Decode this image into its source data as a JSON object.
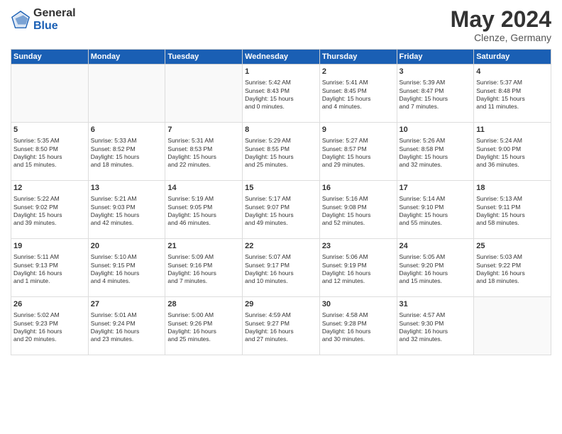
{
  "header": {
    "logo_general": "General",
    "logo_blue": "Blue",
    "month_title": "May 2024",
    "location": "Clenze, Germany"
  },
  "weekdays": [
    "Sunday",
    "Monday",
    "Tuesday",
    "Wednesday",
    "Thursday",
    "Friday",
    "Saturday"
  ],
  "weeks": [
    [
      {
        "day": "",
        "info": ""
      },
      {
        "day": "",
        "info": ""
      },
      {
        "day": "",
        "info": ""
      },
      {
        "day": "1",
        "info": "Sunrise: 5:42 AM\nSunset: 8:43 PM\nDaylight: 15 hours\nand 0 minutes."
      },
      {
        "day": "2",
        "info": "Sunrise: 5:41 AM\nSunset: 8:45 PM\nDaylight: 15 hours\nand 4 minutes."
      },
      {
        "day": "3",
        "info": "Sunrise: 5:39 AM\nSunset: 8:47 PM\nDaylight: 15 hours\nand 7 minutes."
      },
      {
        "day": "4",
        "info": "Sunrise: 5:37 AM\nSunset: 8:48 PM\nDaylight: 15 hours\nand 11 minutes."
      }
    ],
    [
      {
        "day": "5",
        "info": "Sunrise: 5:35 AM\nSunset: 8:50 PM\nDaylight: 15 hours\nand 15 minutes."
      },
      {
        "day": "6",
        "info": "Sunrise: 5:33 AM\nSunset: 8:52 PM\nDaylight: 15 hours\nand 18 minutes."
      },
      {
        "day": "7",
        "info": "Sunrise: 5:31 AM\nSunset: 8:53 PM\nDaylight: 15 hours\nand 22 minutes."
      },
      {
        "day": "8",
        "info": "Sunrise: 5:29 AM\nSunset: 8:55 PM\nDaylight: 15 hours\nand 25 minutes."
      },
      {
        "day": "9",
        "info": "Sunrise: 5:27 AM\nSunset: 8:57 PM\nDaylight: 15 hours\nand 29 minutes."
      },
      {
        "day": "10",
        "info": "Sunrise: 5:26 AM\nSunset: 8:58 PM\nDaylight: 15 hours\nand 32 minutes."
      },
      {
        "day": "11",
        "info": "Sunrise: 5:24 AM\nSunset: 9:00 PM\nDaylight: 15 hours\nand 36 minutes."
      }
    ],
    [
      {
        "day": "12",
        "info": "Sunrise: 5:22 AM\nSunset: 9:02 PM\nDaylight: 15 hours\nand 39 minutes."
      },
      {
        "day": "13",
        "info": "Sunrise: 5:21 AM\nSunset: 9:03 PM\nDaylight: 15 hours\nand 42 minutes."
      },
      {
        "day": "14",
        "info": "Sunrise: 5:19 AM\nSunset: 9:05 PM\nDaylight: 15 hours\nand 46 minutes."
      },
      {
        "day": "15",
        "info": "Sunrise: 5:17 AM\nSunset: 9:07 PM\nDaylight: 15 hours\nand 49 minutes."
      },
      {
        "day": "16",
        "info": "Sunrise: 5:16 AM\nSunset: 9:08 PM\nDaylight: 15 hours\nand 52 minutes."
      },
      {
        "day": "17",
        "info": "Sunrise: 5:14 AM\nSunset: 9:10 PM\nDaylight: 15 hours\nand 55 minutes."
      },
      {
        "day": "18",
        "info": "Sunrise: 5:13 AM\nSunset: 9:11 PM\nDaylight: 15 hours\nand 58 minutes."
      }
    ],
    [
      {
        "day": "19",
        "info": "Sunrise: 5:11 AM\nSunset: 9:13 PM\nDaylight: 16 hours\nand 1 minute."
      },
      {
        "day": "20",
        "info": "Sunrise: 5:10 AM\nSunset: 9:15 PM\nDaylight: 16 hours\nand 4 minutes."
      },
      {
        "day": "21",
        "info": "Sunrise: 5:09 AM\nSunset: 9:16 PM\nDaylight: 16 hours\nand 7 minutes."
      },
      {
        "day": "22",
        "info": "Sunrise: 5:07 AM\nSunset: 9:17 PM\nDaylight: 16 hours\nand 10 minutes."
      },
      {
        "day": "23",
        "info": "Sunrise: 5:06 AM\nSunset: 9:19 PM\nDaylight: 16 hours\nand 12 minutes."
      },
      {
        "day": "24",
        "info": "Sunrise: 5:05 AM\nSunset: 9:20 PM\nDaylight: 16 hours\nand 15 minutes."
      },
      {
        "day": "25",
        "info": "Sunrise: 5:03 AM\nSunset: 9:22 PM\nDaylight: 16 hours\nand 18 minutes."
      }
    ],
    [
      {
        "day": "26",
        "info": "Sunrise: 5:02 AM\nSunset: 9:23 PM\nDaylight: 16 hours\nand 20 minutes."
      },
      {
        "day": "27",
        "info": "Sunrise: 5:01 AM\nSunset: 9:24 PM\nDaylight: 16 hours\nand 23 minutes."
      },
      {
        "day": "28",
        "info": "Sunrise: 5:00 AM\nSunset: 9:26 PM\nDaylight: 16 hours\nand 25 minutes."
      },
      {
        "day": "29",
        "info": "Sunrise: 4:59 AM\nSunset: 9:27 PM\nDaylight: 16 hours\nand 27 minutes."
      },
      {
        "day": "30",
        "info": "Sunrise: 4:58 AM\nSunset: 9:28 PM\nDaylight: 16 hours\nand 30 minutes."
      },
      {
        "day": "31",
        "info": "Sunrise: 4:57 AM\nSunset: 9:30 PM\nDaylight: 16 hours\nand 32 minutes."
      },
      {
        "day": "",
        "info": ""
      }
    ]
  ]
}
